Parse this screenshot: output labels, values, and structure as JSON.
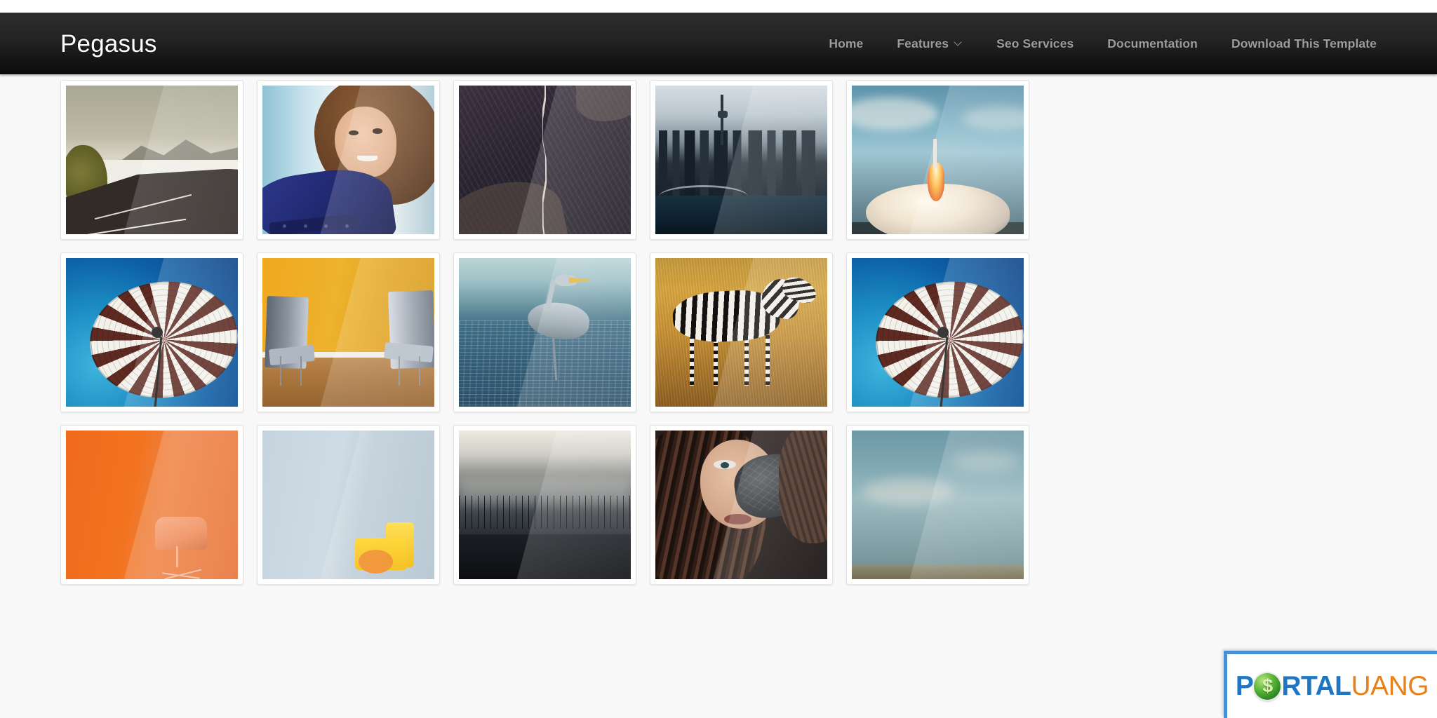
{
  "header": {
    "logo": "Pegasus",
    "nav": [
      {
        "label": "Home",
        "icon": null
      },
      {
        "label": "Features",
        "icon": "chevron-down-icon"
      },
      {
        "label": "Seo Services",
        "icon": null
      },
      {
        "label": "Documentation",
        "icon": null
      },
      {
        "label": "Download This Template",
        "icon": null
      }
    ]
  },
  "gallery": {
    "columns": 5,
    "items": [
      {
        "alt": "Desert highway curving through salt flats",
        "scene": "s-road"
      },
      {
        "alt": "Smiling woman in blue sweater portrait",
        "scene": "s-woman"
      },
      {
        "alt": "Aerial view of winding mountain road",
        "scene": "s-aerial"
      },
      {
        "alt": "City skyline with harbour bridge",
        "scene": "s-city"
      },
      {
        "alt": "Space shuttle rocket launch",
        "scene": "s-rocket"
      },
      {
        "alt": "Striped beach umbrella against blue sky",
        "scene": "s-umb"
      },
      {
        "alt": "Two chairs against a yellow wall",
        "scene": "s-yellow"
      },
      {
        "alt": "Grey heron wading in water",
        "scene": "s-heron"
      },
      {
        "alt": "Zebra standing in dry golden grass",
        "scene": "s-zebra"
      },
      {
        "alt": "Striped beach umbrella against blue sky",
        "scene": "s-umb"
      },
      {
        "alt": "Orange wall with moulded chair",
        "scene": "s-orange"
      },
      {
        "alt": "Pale blue wall with yellow armchair",
        "scene": "s-lblue"
      },
      {
        "alt": "Dark misty landscape with bare trees",
        "scene": "s-misty"
      },
      {
        "alt": "Woman with dark hair wearing a gas mask",
        "scene": "s-mask"
      },
      {
        "alt": "Hazy blue sky over open ground",
        "scene": "s-sky"
      }
    ]
  },
  "watermark": {
    "part1": "P",
    "coin": "dollar-coin-icon",
    "part2": "RTAL",
    "part3": "UANG",
    "full_text": "PORTALUANG"
  },
  "colors": {
    "header_top": "#2e2e2e",
    "header_bottom": "#0b0b0b",
    "page_background": "#f8f8f8",
    "nav_text": "#9c9c9c",
    "logo_text": "#ffffff",
    "watermark_blue": "#1f77c4",
    "watermark_orange": "#e8801b",
    "watermark_border": "#4a8fd4"
  }
}
